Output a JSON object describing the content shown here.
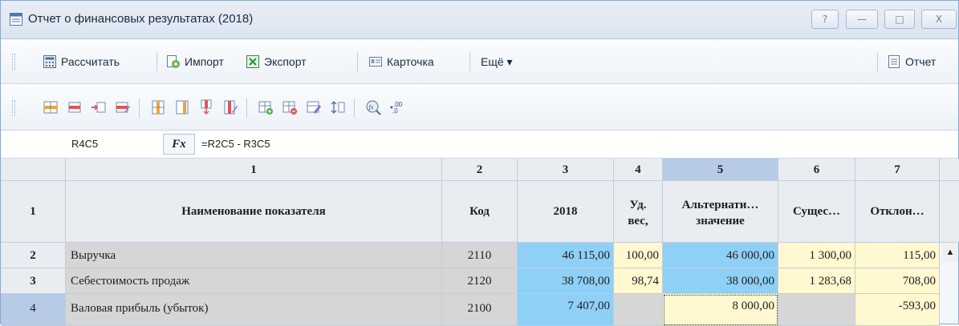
{
  "window": {
    "title": "Отчет о финансовых результатах (2018)",
    "buttons": [
      "?",
      "—",
      "□",
      "X"
    ]
  },
  "toolbar": {
    "calculate": "Рассчитать",
    "import": "Импорт",
    "export": "Экспорт",
    "card": "Карточка",
    "more": "Ещё ▾",
    "report": "Отчет"
  },
  "icon_toolbar": [
    "insert-row-icon",
    "add-row-icon",
    "delete-row-icon",
    "row-properties-icon",
    "insert-column-icon",
    "add-column-icon",
    "delete-column-icon",
    "column-properties-icon",
    "add-sheet-icon",
    "delete-sheet-icon",
    "edit-sheet-icon",
    "sort-icon",
    "function-icon",
    "decimal-icon"
  ],
  "formula_bar": {
    "cell_ref": "R4C5",
    "fx_label": "Fx",
    "formula": "=R2C5 - R3C5"
  },
  "grid": {
    "col_numbers": [
      "1",
      "2",
      "3",
      "4",
      "5",
      "6",
      "7"
    ],
    "headers": {
      "row_num": "1",
      "name": "Наименование показателя",
      "code": "Код",
      "year": "2018",
      "share_1": "Уд.",
      "share_2": "вес,",
      "alt_1": "Альтернати…",
      "alt_2": "значение",
      "sig": "Сущес…",
      "dev": "Отклон…"
    },
    "rows": [
      {
        "num": "2",
        "name": "Выручка",
        "code": "2110",
        "year": "46 115,00",
        "share": "100,00",
        "alt": "46 000,00",
        "sig": "1 300,00",
        "dev": "115,00"
      },
      {
        "num": "3",
        "name": "Себестоимость продаж",
        "code": "2120",
        "year": "38 708,00",
        "share": "98,74",
        "alt": "38 000,00",
        "sig": "1 283,68",
        "dev": "708,00"
      },
      {
        "num": "4",
        "name": "Валовая прибыль (убыток)",
        "code": "2100",
        "year": "7 407,00",
        "share": "",
        "alt": "8 000,00",
        "sig": "",
        "dev": "-593,00"
      }
    ]
  },
  "colors": {
    "computed_blue": "#8fd0f7",
    "input_yellow": "#fff8d0",
    "locked_grey": "#d6d6d6",
    "selected_header": "#b7cbe6"
  }
}
